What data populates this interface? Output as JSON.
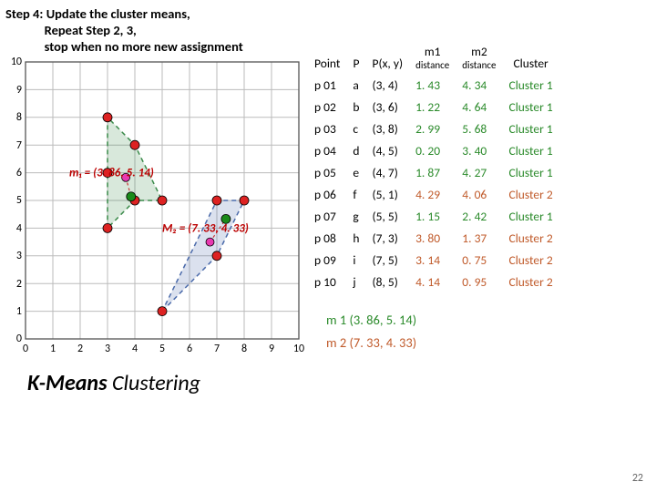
{
  "step_title": "Step 4: Update the cluster means,\n             Repeat Step 2, 3,\n             stop when no more new assignment",
  "headers": {
    "point": "Point",
    "p": "P",
    "pxy": "P(x, y)",
    "m1": "m1",
    "m2": "m2",
    "dist": "distance",
    "cluster": "Cluster"
  },
  "rows": [
    {
      "pt": "p 01",
      "p": "a",
      "xy": "(3, 4)",
      "d1": "1. 43",
      "d2": "4. 34",
      "cl": "Cluster 1",
      "cn": 1
    },
    {
      "pt": "p 02",
      "p": "b",
      "xy": "(3, 6)",
      "d1": "1. 22",
      "d2": "4. 64",
      "cl": "Cluster 1",
      "cn": 1
    },
    {
      "pt": "p 03",
      "p": "c",
      "xy": "(3, 8)",
      "d1": "2. 99",
      "d2": "5. 68",
      "cl": "Cluster 1",
      "cn": 1
    },
    {
      "pt": "p 04",
      "p": "d",
      "xy": "(4, 5)",
      "d1": "0. 20",
      "d2": "3. 40",
      "cl": "Cluster 1",
      "cn": 1
    },
    {
      "pt": "p 05",
      "p": "e",
      "xy": "(4, 7)",
      "d1": "1. 87",
      "d2": "4. 27",
      "cl": "Cluster 1",
      "cn": 1
    },
    {
      "pt": "p 06",
      "p": "f",
      "xy": "(5, 1)",
      "d1": "4. 29",
      "d2": "4. 06",
      "cl": "Cluster 2",
      "cn": 2
    },
    {
      "pt": "p 07",
      "p": "g",
      "xy": "(5, 5)",
      "d1": "1. 15",
      "d2": "2. 42",
      "cl": "Cluster 1",
      "cn": 1
    },
    {
      "pt": "p 08",
      "p": "h",
      "xy": "(7, 3)",
      "d1": "3. 80",
      "d2": "1. 37",
      "cl": "Cluster 2",
      "cn": 2
    },
    {
      "pt": "p 09",
      "p": "i",
      "xy": "(7, 5)",
      "d1": "3. 14",
      "d2": "0. 75",
      "cl": "Cluster 2",
      "cn": 2
    },
    {
      "pt": "p 10",
      "p": "j",
      "xy": "(8, 5)",
      "d1": "4. 14",
      "d2": "0. 95",
      "cl": "Cluster 2",
      "cn": 2
    }
  ],
  "chart_data": {
    "type": "scatter",
    "xlim": [
      0,
      10
    ],
    "ylim": [
      0,
      10
    ],
    "xticks": [
      0,
      1,
      2,
      3,
      4,
      5,
      6,
      7,
      8,
      9,
      10
    ],
    "yticks": [
      0,
      1,
      2,
      3,
      4,
      5,
      6,
      7,
      8,
      9,
      10
    ],
    "points": [
      {
        "x": 3,
        "y": 4
      },
      {
        "x": 3,
        "y": 6
      },
      {
        "x": 3,
        "y": 8
      },
      {
        "x": 4,
        "y": 5
      },
      {
        "x": 4,
        "y": 7
      },
      {
        "x": 5,
        "y": 1
      },
      {
        "x": 5,
        "y": 5
      },
      {
        "x": 7,
        "y": 3
      },
      {
        "x": 7,
        "y": 5
      },
      {
        "x": 8,
        "y": 5
      }
    ],
    "prev_centroids": [
      {
        "x": 3.67,
        "y": 5.83
      },
      {
        "x": 6.75,
        "y": 3.5
      }
    ],
    "centroids": [
      {
        "name": "m1",
        "x": 3.86,
        "y": 5.14,
        "label": "m₁ = (3. 86, 5. 14)"
      },
      {
        "name": "m2",
        "x": 7.33,
        "y": 4.33,
        "label": "M₂ = (7. 33, 4. 33)"
      }
    ],
    "hull1": [
      [
        3,
        4
      ],
      [
        3,
        8
      ],
      [
        4,
        7
      ],
      [
        5,
        5
      ],
      [
        4,
        5
      ]
    ],
    "hull2": [
      [
        5,
        1
      ],
      [
        7,
        3
      ],
      [
        8,
        5
      ],
      [
        7,
        5
      ]
    ]
  },
  "centroid_lines": {
    "m1": "m 1  (3. 86, 5. 14)",
    "m2": "m 2  (7. 33, 4. 33)"
  },
  "bigtitle_bold": "K-Means",
  "bigtitle_rest": " Clustering",
  "page": "22"
}
